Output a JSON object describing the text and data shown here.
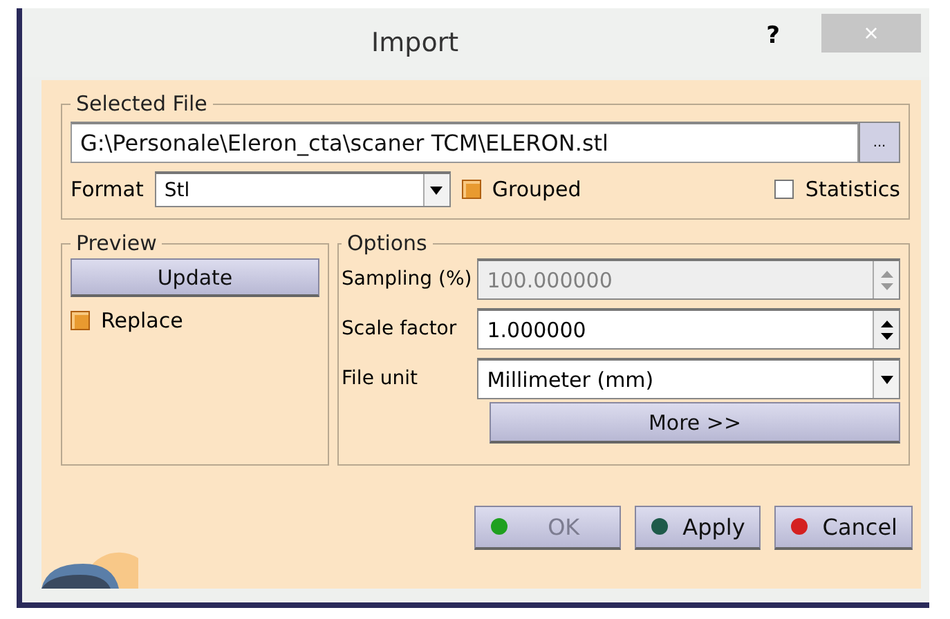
{
  "window": {
    "title": "Import",
    "help": "?",
    "close": "×"
  },
  "selected_file": {
    "legend": "Selected File",
    "path": "G:\\Personale\\Eleron_cta\\scaner TCM\\ELERON.stl",
    "browse": "...",
    "format_label": "Format",
    "format_value": "Stl",
    "grouped": {
      "label": "Grouped",
      "checked": true
    },
    "statistics": {
      "label": "Statistics",
      "checked": false
    }
  },
  "preview": {
    "legend": "Preview",
    "update": "Update",
    "replace": {
      "label": "Replace",
      "checked": true
    }
  },
  "options": {
    "legend": "Options",
    "fields": [
      {
        "kind": "spin",
        "label": "Sampling (%)",
        "value": "100.000000",
        "disabled": true
      },
      {
        "kind": "spin",
        "label": "Scale factor",
        "value": "1.000000",
        "disabled": false
      },
      {
        "kind": "dropdown",
        "label": "File unit",
        "value": "Millimeter (mm)",
        "disabled": false
      }
    ],
    "more": "More >>"
  },
  "buttons": [
    {
      "label": "OK",
      "disabled": true,
      "color": "#1fa01f"
    },
    {
      "label": "Apply",
      "disabled": false,
      "color": "#1e5a4a"
    },
    {
      "label": "Cancel",
      "disabled": false,
      "color": "#d42020"
    }
  ]
}
